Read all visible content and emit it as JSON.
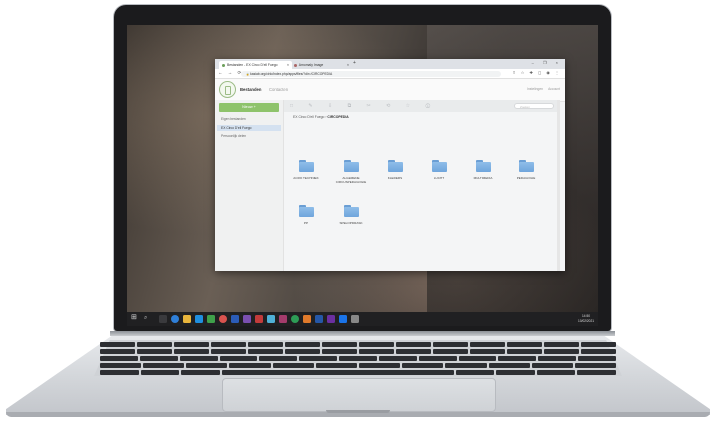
{
  "browser": {
    "tabs": [
      {
        "label": "Bestanden - EX Circo D'ell Fuego",
        "close": "×"
      },
      {
        "label": "Amomaly Image",
        "close": "×"
      }
    ],
    "new_tab": "+",
    "window_controls": "– ❐ ×",
    "nav_buttons": "← → ⟳",
    "lock_icon": "🔒",
    "url": "kasiab.org/cirlo/index.php/apps/files/?dir=/CIRCOPEDIA",
    "extensions": "⇪ ☆ ✚ ◻ ◉ ⋮"
  },
  "app": {
    "nav": {
      "files": "Bestanden",
      "contacts": "Contacten"
    },
    "header_right": {
      "item1": "Instelingen",
      "item2": "Account"
    },
    "sidebar": {
      "new_button": "Nieuw +",
      "items": [
        {
          "label": "Eigen bestanden"
        },
        {
          "label": "EX Circo D'ell Fuego"
        },
        {
          "label": "Persoonlijk delen"
        }
      ]
    },
    "toolbar": {
      "icons": "□ ✎ ⇩ ⧉ ✂ ⟲ ☆ ⓘ",
      "search_placeholder": "Zoeken"
    },
    "breadcrumb": {
      "root": "EX Circo D'ell Fuego",
      "separator": "›",
      "current": "CIRCOPEDIA"
    },
    "folders": [
      {
        "name": "ACRO TECHNIEK"
      },
      {
        "name": "ALGEMENE CIRCUSPEDAGOGIE"
      },
      {
        "name": "KLEDERS"
      },
      {
        "name": "LUCHT"
      },
      {
        "name": "MULTIMEDIA"
      },
      {
        "name": "PEDAGOGIE"
      },
      {
        "name": "PP"
      },
      {
        "name": "SPELOPDRASK"
      }
    ]
  },
  "taskbar": {
    "start_icon": "⊞",
    "search_icon": "⌕",
    "tray_line1": "14:50",
    "tray_line2": "10/02/2021"
  },
  "colors": {
    "accent_green": "#8ec36b",
    "folder_blue": "#6fa5dc",
    "selected_nav": "#d4e1f0"
  }
}
